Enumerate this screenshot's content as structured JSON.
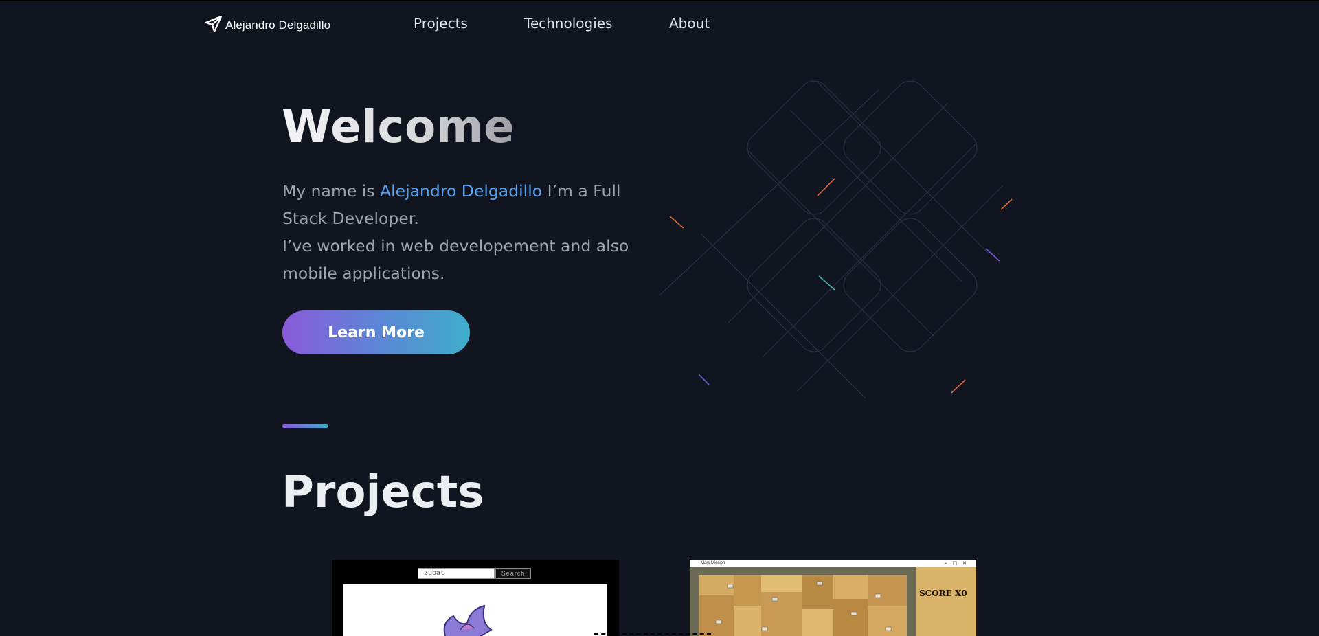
{
  "nav": {
    "brand": "Alejandro Delgadillo",
    "links": [
      "Projects",
      "Technologies",
      "About"
    ]
  },
  "hero": {
    "title": "Welcome",
    "intro_before": "My name is ",
    "intro_name": "Alejandro Delgadillo",
    "intro_after": " I’m a Full Stack Developer.",
    "intro_line2": "I’ve worked in web developement and also mobile applications.",
    "cta_label": "Learn More"
  },
  "projects": {
    "title": "Projects",
    "cards": [
      {
        "search_value": "zubat",
        "search_button": "Search"
      },
      {
        "window_title": "Mars Mission",
        "score_text": "SCORE X0"
      }
    ]
  },
  "colors": {
    "background": "#111520",
    "accent_blue": "#5aa3f0",
    "gradient_start": "#8a5ad9",
    "gradient_end": "#3faecb"
  },
  "icons": {
    "brand": "paper-plane-icon",
    "sprite": "zubat-sprite-icon"
  }
}
